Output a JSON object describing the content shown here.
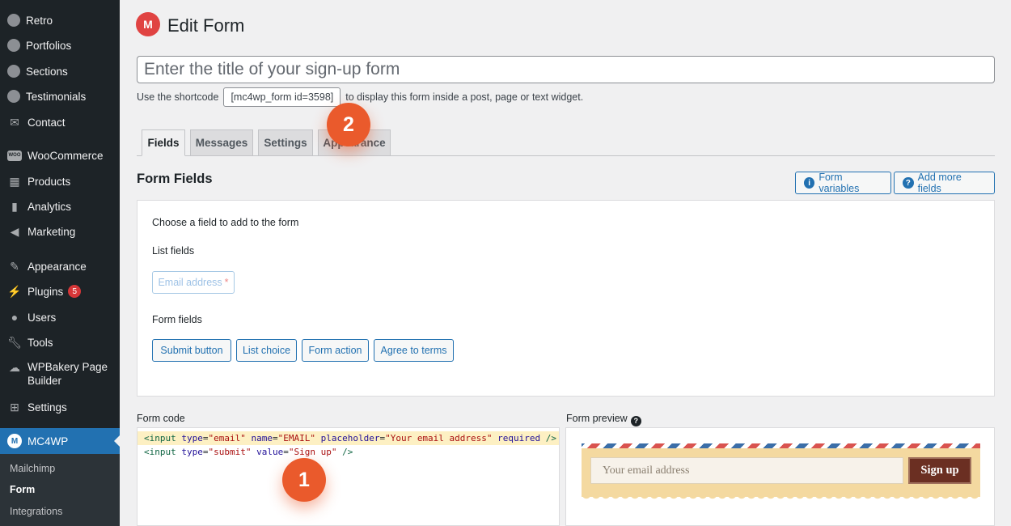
{
  "sidebar": {
    "items": [
      {
        "label": "Retro",
        "icon": "avatar-icon"
      },
      {
        "label": "Portfolios",
        "icon": "avatar-icon"
      },
      {
        "label": "Sections",
        "icon": "avatar-icon"
      },
      {
        "label": "Testimonials",
        "icon": "avatar-icon"
      },
      {
        "label": "Contact",
        "icon": "envelope-icon"
      },
      {
        "label": "WooCommerce",
        "icon": "woo-icon"
      },
      {
        "label": "Products",
        "icon": "archive-icon"
      },
      {
        "label": "Analytics",
        "icon": "bar-chart-icon"
      },
      {
        "label": "Marketing",
        "icon": "megaphone-icon"
      },
      {
        "label": "Appearance",
        "icon": "paintbrush-icon"
      },
      {
        "label": "Plugins",
        "icon": "plug-icon",
        "badge": "5"
      },
      {
        "label": "Users",
        "icon": "user-icon"
      },
      {
        "label": "Tools",
        "icon": "wrench-icon"
      },
      {
        "label": "WPBakery Page Builder",
        "icon": "cloud-icon"
      },
      {
        "label": "Settings",
        "icon": "sliders-icon"
      }
    ],
    "active": {
      "label": "MC4WP",
      "icon": "mc4wp-icon"
    },
    "submenu": [
      "Mailchimp",
      "Form",
      "Integrations"
    ]
  },
  "header": {
    "title": "Edit Form"
  },
  "form_title": {
    "placeholder": "Enter the title of your sign-up form"
  },
  "shortcode": {
    "prefix": "Use the shortcode",
    "code": "[mc4wp_form id=3598]",
    "suffix": "to display this form inside a post, page or text widget."
  },
  "tabs": [
    "Fields",
    "Messages",
    "Settings",
    "Appearance"
  ],
  "form_fields": {
    "title": "Form Fields",
    "variables_button": "Form variables",
    "add_more_button": "Add more fields",
    "choose_text": "Choose a field to add to the form",
    "list_fields_label": "List fields",
    "email_field": "Email address",
    "required_mark": "*",
    "form_fields_label": "Form fields",
    "form_field_buttons": [
      "Submit button",
      "List choice",
      "Form action",
      "Agree to terms"
    ]
  },
  "form_code": {
    "label": "Form code",
    "line1": {
      "t1": "<input",
      "a1": "type",
      "v1": "\"email\"",
      "a2": "name",
      "v2": "\"EMAIL\"",
      "a3": "placeholder",
      "v3": "\"Your email address\"",
      "a4": "required",
      "t2": "/>"
    },
    "line2": {
      "t1": "<input",
      "a1": "type",
      "v1": "\"submit\"",
      "a2": "value",
      "v2": "\"Sign up\"",
      "t2": "/>"
    }
  },
  "form_preview": {
    "label": "Form preview",
    "help_icon": "?",
    "email_placeholder": "Your email address",
    "button_label": "Sign up"
  },
  "markers": [
    "1",
    "2"
  ]
}
